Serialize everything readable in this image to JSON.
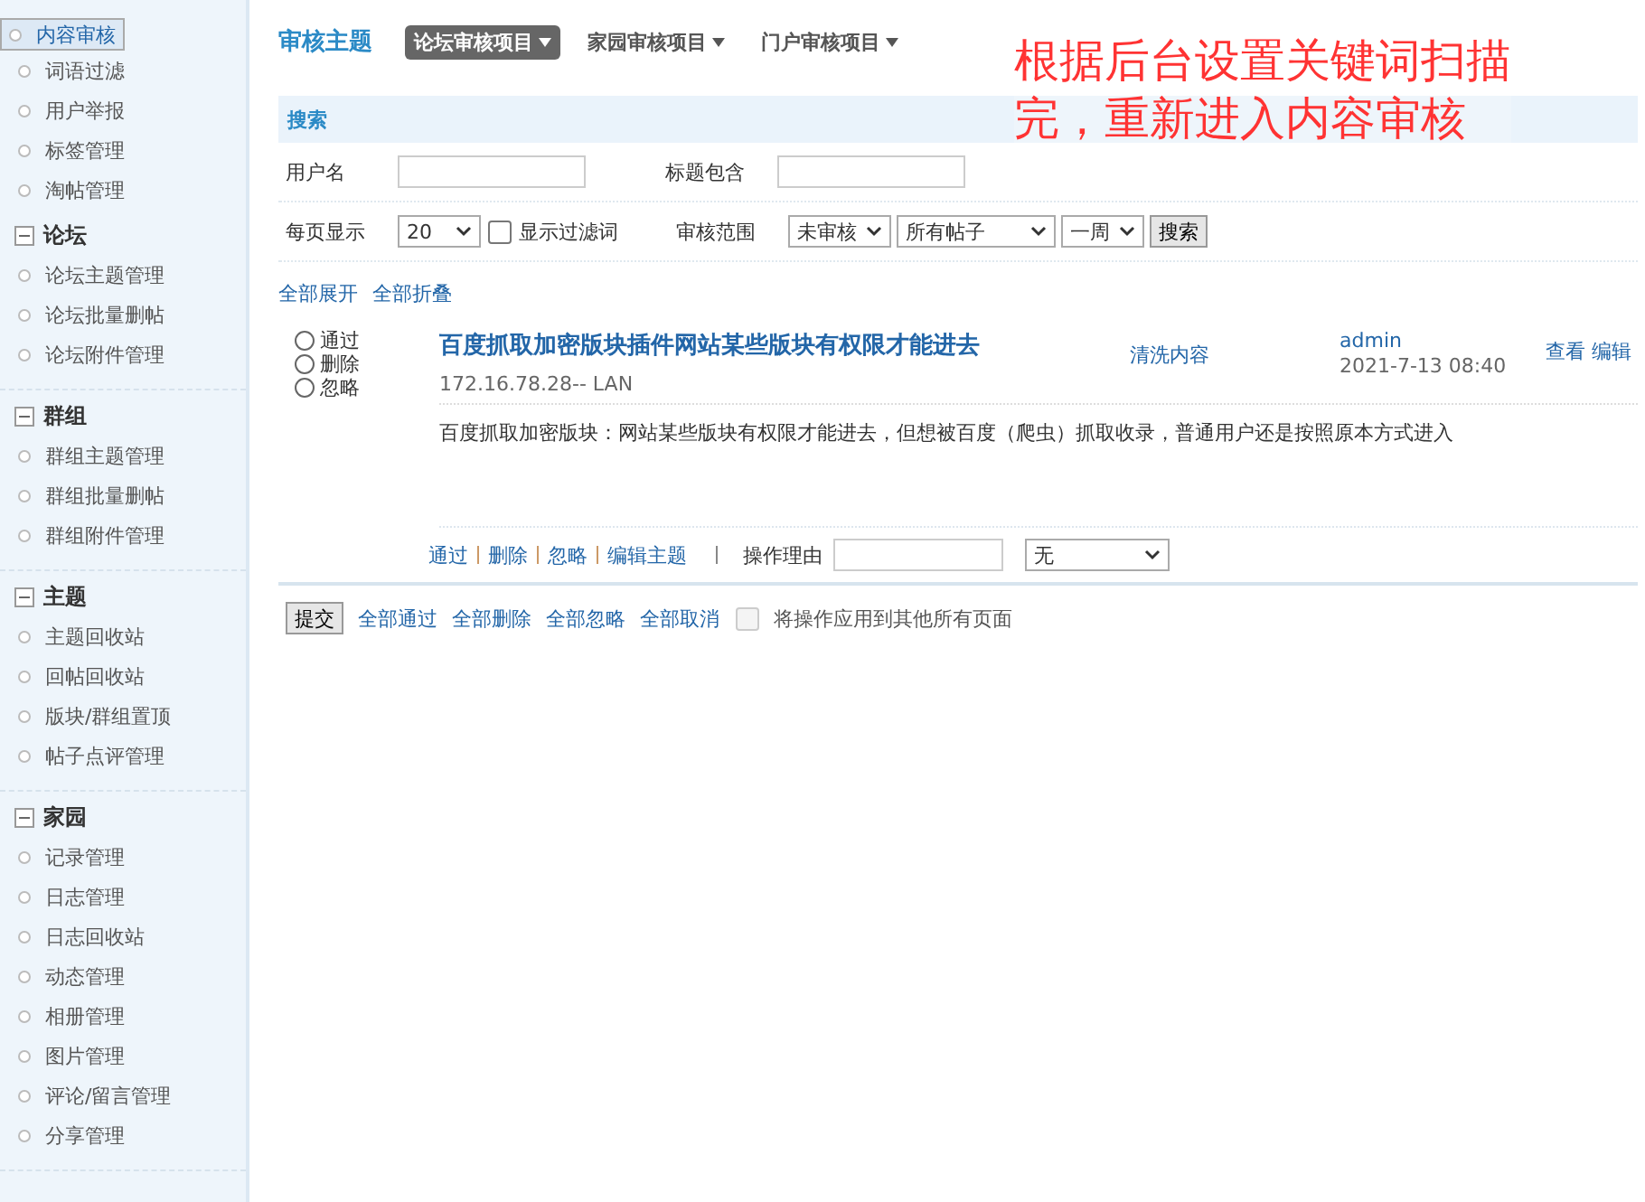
{
  "sidebar": {
    "groups": [
      {
        "items": [
          {
            "label": "内容审核",
            "selected": true
          },
          {
            "label": "词语过滤",
            "selected": false
          },
          {
            "label": "用户举报",
            "selected": false
          },
          {
            "label": "标签管理",
            "selected": false
          },
          {
            "label": "淘帖管理",
            "selected": false
          }
        ]
      },
      {
        "title": "论坛",
        "expanded": true,
        "items": [
          {
            "label": "论坛主题管理",
            "selected": false
          },
          {
            "label": "论坛批量删帖",
            "selected": false
          },
          {
            "label": "论坛附件管理",
            "selected": false
          }
        ]
      },
      {
        "title": "群组",
        "expanded": true,
        "items": [
          {
            "label": "群组主题管理",
            "selected": false
          },
          {
            "label": "群组批量删帖",
            "selected": false
          },
          {
            "label": "群组附件管理",
            "selected": false
          }
        ]
      },
      {
        "title": "主题",
        "expanded": true,
        "items": [
          {
            "label": "主题回收站",
            "selected": false
          },
          {
            "label": "回帖回收站",
            "selected": false
          },
          {
            "label": "版块/群组置顶",
            "selected": false
          },
          {
            "label": "帖子点评管理",
            "selected": false
          }
        ]
      },
      {
        "title": "家园",
        "expanded": true,
        "items": [
          {
            "label": "记录管理",
            "selected": false
          },
          {
            "label": "日志管理",
            "selected": false
          },
          {
            "label": "日志回收站",
            "selected": false
          },
          {
            "label": "动态管理",
            "selected": false
          },
          {
            "label": "相册管理",
            "selected": false
          },
          {
            "label": "图片管理",
            "selected": false
          },
          {
            "label": "评论/留言管理",
            "selected": false
          },
          {
            "label": "分享管理",
            "selected": false
          }
        ]
      }
    ]
  },
  "page_title": "审核主题",
  "tabs": [
    {
      "label": "论坛审核项目",
      "selected": true
    },
    {
      "label": "家园审核项目",
      "selected": false
    },
    {
      "label": "门户审核项目",
      "selected": false
    }
  ],
  "annotation": [
    "根据后台设置关键词扫描",
    "完，重新进入内容审核"
  ],
  "search": {
    "title": "搜索",
    "username_label": "用户名",
    "title_label": "标题包含",
    "per_page_label": "每页显示",
    "per_page": "20",
    "show_filtered": {
      "label": "显示过滤词",
      "checked": false
    },
    "scope_label": "审核范围",
    "status": "未审核",
    "posts": "所有帖子",
    "period": "一周",
    "button": "搜索"
  },
  "expand_all": "全部展开",
  "collapse_all": "全部折叠",
  "posts": [
    {
      "options": [
        {
          "label": "通过",
          "selected": false
        },
        {
          "label": "删除",
          "selected": false
        },
        {
          "label": "忽略",
          "selected": false
        }
      ],
      "title": "百度抓取加密版块插件网站某些版块有权限才能进去",
      "ip": "172.16.78.28-- LAN",
      "forum": "清洗内容",
      "author": "admin",
      "date": "2021-7-13 08:40",
      "view": "查看",
      "edit": "编辑",
      "body": "百度抓取加密版块：网站某些版块有权限才能进去，但想被百度（爬虫）抓取收录，普通用户还是按照原本方式进入",
      "actions": [
        "通过",
        "删除",
        "忽略",
        "编辑主题"
      ],
      "reason_label": "操作理由",
      "reason_select": "无"
    }
  ],
  "footer": {
    "submit": "提交",
    "links": [
      "全部通过",
      "全部删除",
      "全部忽略",
      "全部取消"
    ],
    "apply_all": {
      "label": "将操作应用到其他所有页面",
      "checked": false,
      "disabled": true
    }
  }
}
